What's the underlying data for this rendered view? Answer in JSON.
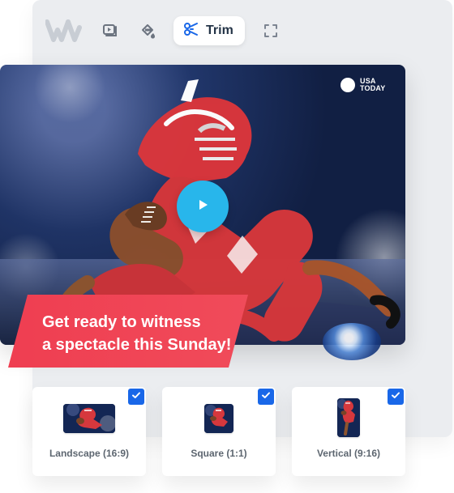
{
  "toolbar": {
    "logo": "w-logo",
    "icons": {
      "media": "video-icon",
      "fill": "paint-bucket-icon",
      "trim": "scissors-icon",
      "fullscreen": "fullscreen-icon"
    },
    "trim_label": "Trim"
  },
  "preview": {
    "brand_logo_text": "USA\nTODAY",
    "caption": "Get ready to witness\na spectacle this Sunday!",
    "play_icon": "play-icon"
  },
  "formats": [
    {
      "label": "Landscape (16:9)",
      "selected": true
    },
    {
      "label": "Square (1:1)",
      "selected": true
    },
    {
      "label": "Vertical (9:16)",
      "selected": true
    }
  ],
  "colors": {
    "accent_blue": "#1967e8",
    "play_blue": "#28b6eb",
    "caption_red": "#ef3e51",
    "panel_gray": "#ebedf0"
  }
}
